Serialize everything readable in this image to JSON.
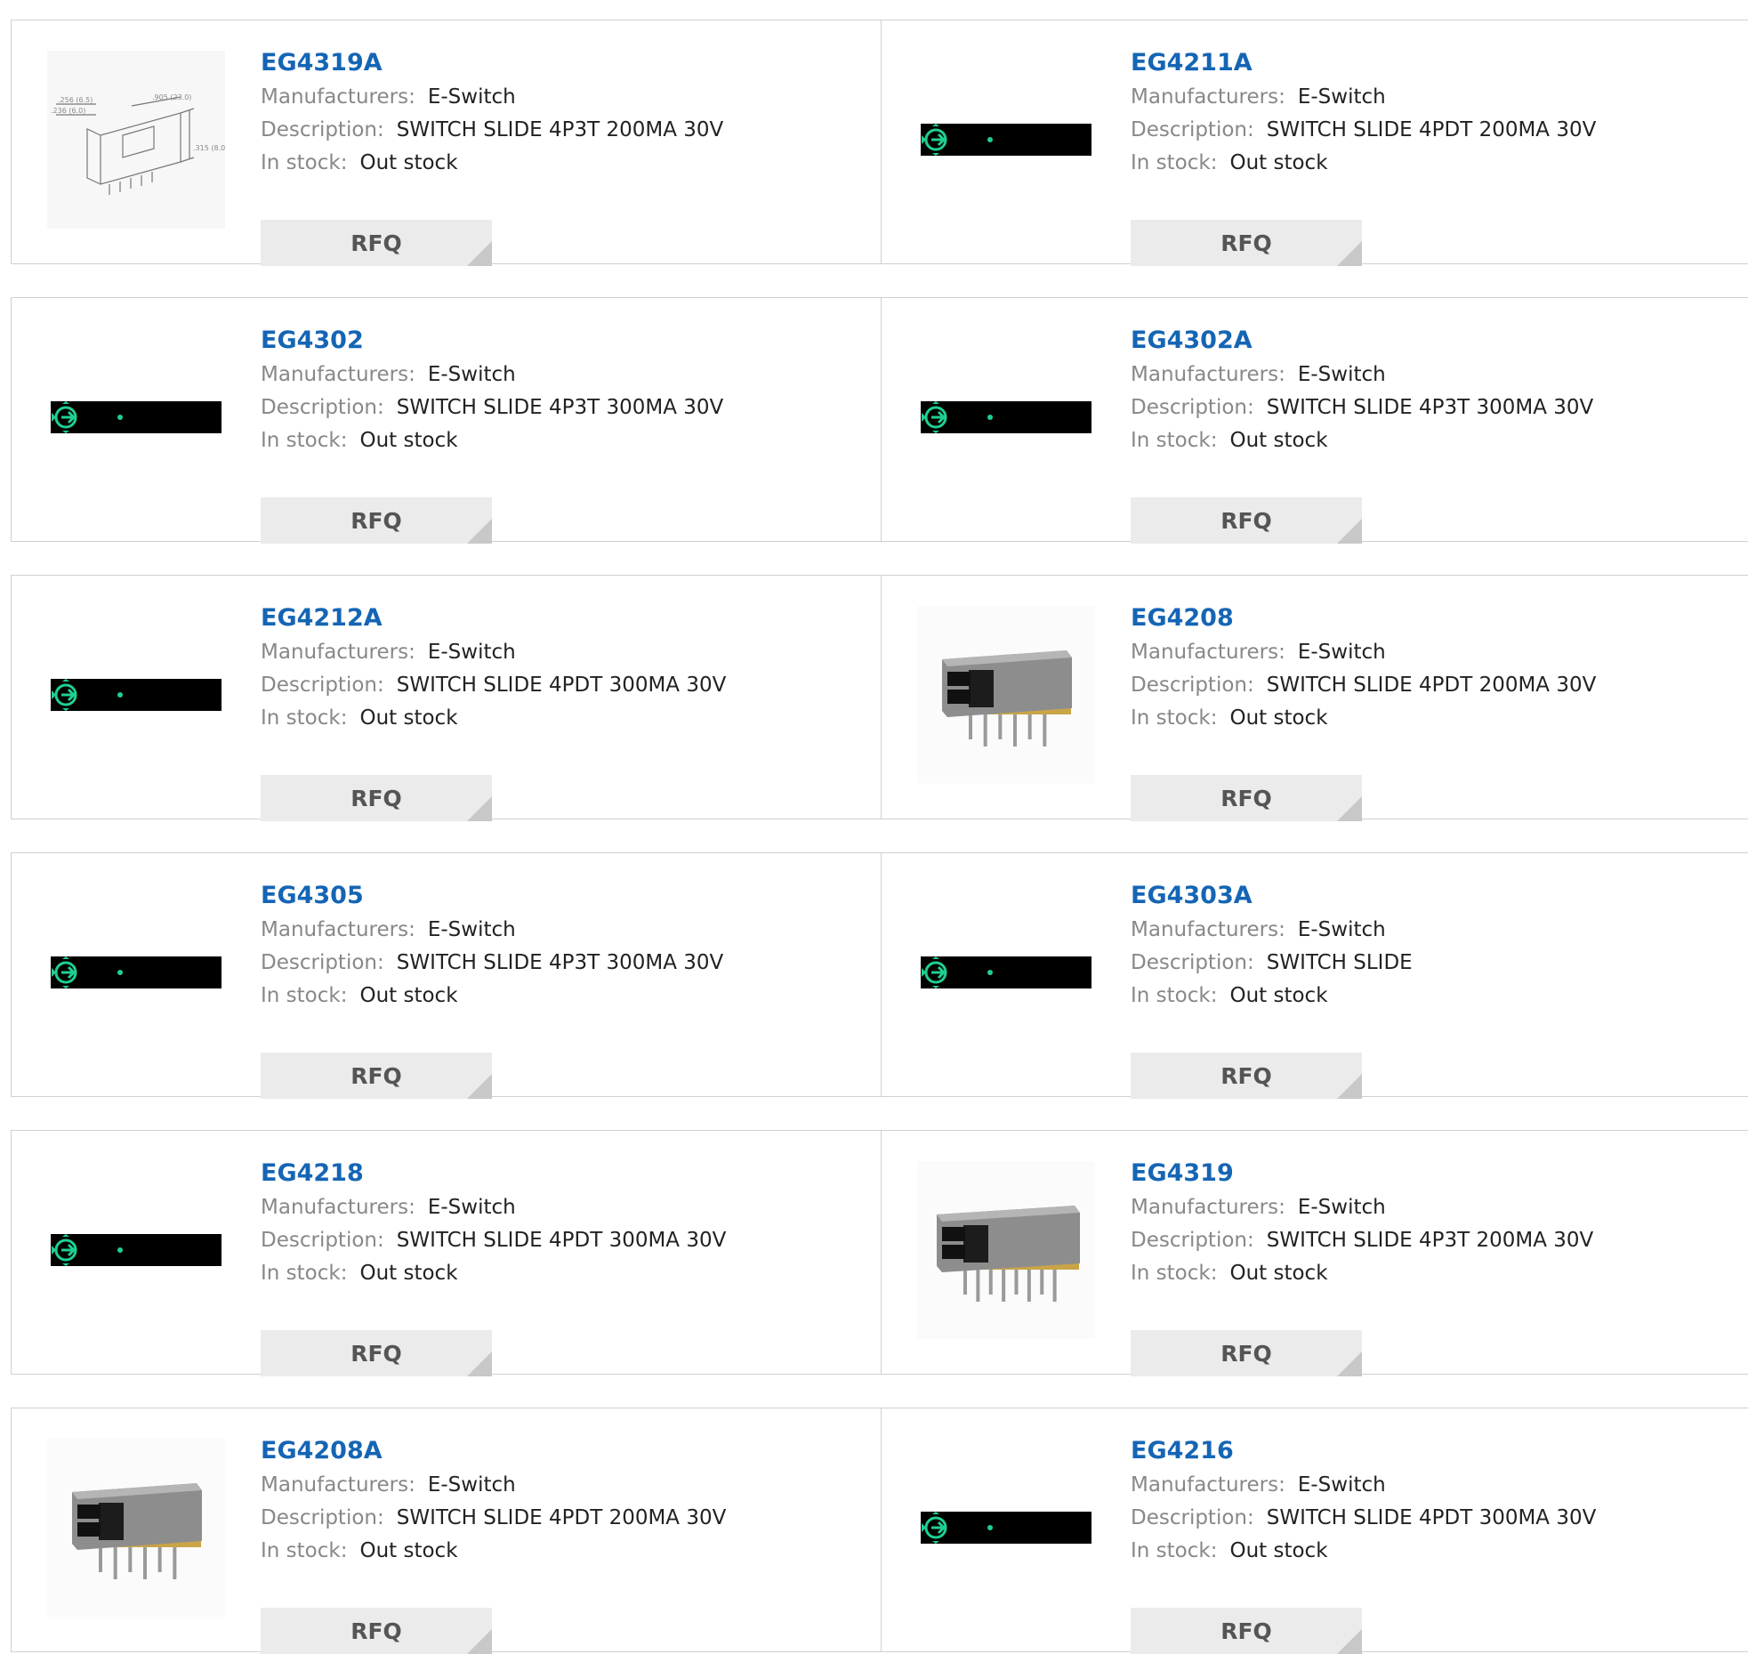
{
  "labels": {
    "manufacturers": "Manufacturers:",
    "description": "Description:",
    "in_stock": "In stock:",
    "rfq": "RFQ"
  },
  "products": [
    {
      "part": "EG4319A",
      "manufacturer": "E-Switch",
      "description": "SWITCH SLIDE 4P3T 200MA 30V",
      "stock": "Out stock",
      "image": "drawing"
    },
    {
      "part": "EG4211A",
      "manufacturer": "E-Switch",
      "description": "SWITCH SLIDE 4PDT 200MA 30V",
      "stock": "Out stock",
      "image": "placeholder"
    },
    {
      "part": "EG4302",
      "manufacturer": "E-Switch",
      "description": "SWITCH SLIDE 4P3T 300MA 30V",
      "stock": "Out stock",
      "image": "placeholder"
    },
    {
      "part": "EG4302A",
      "manufacturer": "E-Switch",
      "description": "SWITCH SLIDE 4P3T 300MA 30V",
      "stock": "Out stock",
      "image": "placeholder"
    },
    {
      "part": "EG4212A",
      "manufacturer": "E-Switch",
      "description": "SWITCH SLIDE 4PDT 300MA 30V",
      "stock": "Out stock",
      "image": "placeholder"
    },
    {
      "part": "EG4208",
      "manufacturer": "E-Switch",
      "description": "SWITCH SLIDE 4PDT 200MA 30V",
      "stock": "Out stock",
      "image": "photo"
    },
    {
      "part": "EG4305",
      "manufacturer": "E-Switch",
      "description": "SWITCH SLIDE 4P3T 300MA 30V",
      "stock": "Out stock",
      "image": "placeholder"
    },
    {
      "part": "EG4303A",
      "manufacturer": "E-Switch",
      "description": "SWITCH SLIDE",
      "stock": "Out stock",
      "image": "placeholder"
    },
    {
      "part": "EG4218",
      "manufacturer": "E-Switch",
      "description": "SWITCH SLIDE 4PDT 300MA 30V",
      "stock": "Out stock",
      "image": "placeholder"
    },
    {
      "part": "EG4319",
      "manufacturer": "E-Switch",
      "description": "SWITCH SLIDE 4P3T 200MA 30V",
      "stock": "Out stock",
      "image": "photo-long"
    },
    {
      "part": "EG4208A",
      "manufacturer": "E-Switch",
      "description": "SWITCH SLIDE 4PDT 200MA 30V",
      "stock": "Out stock",
      "image": "photo"
    },
    {
      "part": "EG4216",
      "manufacturer": "E-Switch",
      "description": "SWITCH SLIDE 4PDT 300MA 30V",
      "stock": "Out stock",
      "image": "placeholder"
    }
  ],
  "colors": {
    "link": "#1565b4",
    "label": "#888888",
    "value": "#222222",
    "button_bg": "#ebebeb",
    "placeholder_icon": "#1fd08f"
  }
}
